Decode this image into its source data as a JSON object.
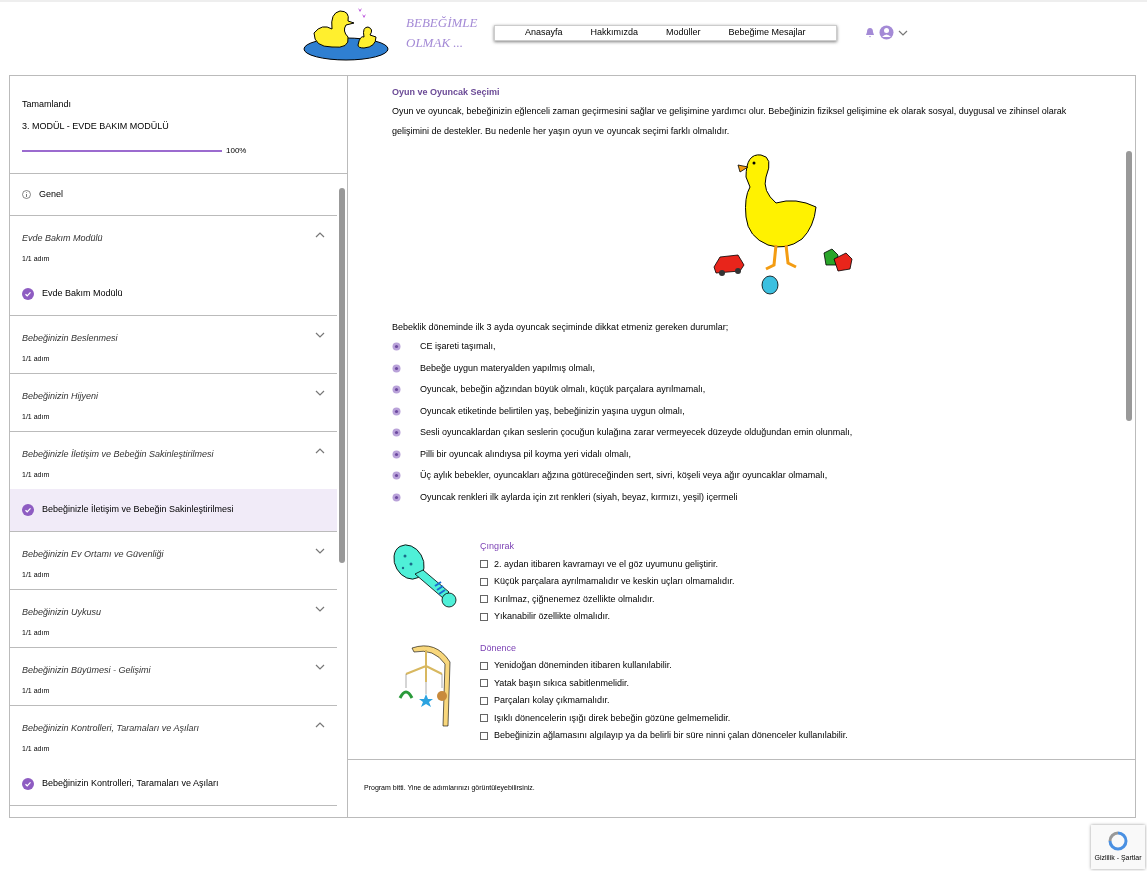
{
  "header": {
    "brand_lines": [
      "BEBEĞİMLE",
      "OLMAK ..."
    ],
    "nav": [
      {
        "label": "Anasayfa",
        "selected": false
      },
      {
        "label": "Hakkımızda",
        "selected": false
      },
      {
        "label": "Modüller",
        "selected": false
      },
      {
        "label": "Bebeğime Mesajlar",
        "selected": false
      }
    ]
  },
  "sidebar": {
    "status": "Tamamlandı",
    "module_title": "3. MODÜL - EVDE BAKIM MODÜLÜ",
    "progress": {
      "level": 1,
      "reading": "100%"
    },
    "general": "Genel",
    "sections": [
      {
        "title": "Evde Bakım Modülü",
        "steps": "1/1 adım",
        "expanded": true,
        "children": [
          {
            "label": "Evde Bakım Modülü",
            "done": true,
            "selected": false
          }
        ]
      },
      {
        "title": "Bebeğinizin Beslenmesi",
        "steps": "1/1 adım",
        "expanded": false
      },
      {
        "title": "Bebeğinizin Hijyeni",
        "steps": "1/1 adım",
        "expanded": false
      },
      {
        "title": "Bebeğinizle İletişim ve Bebeğin Sakinleştirilmesi",
        "steps": "1/1 adım",
        "expanded": true,
        "children": [
          {
            "label": "Bebeğinizle İletişim ve Bebeğin Sakinleştirilmesi",
            "done": true,
            "selected": true
          }
        ]
      },
      {
        "title": "Bebeğinizin Ev Ortamı ve Güvenliği",
        "steps": "1/1 adım",
        "expanded": false
      },
      {
        "title": "Bebeğinizin Uykusu",
        "steps": "1/1 adım",
        "expanded": false
      },
      {
        "title": "Bebeğinizin Büyümesi - Gelişimi",
        "steps": "1/1 adım",
        "expanded": false
      },
      {
        "title": "Bebeğinizin Kontrolleri, Taramaları ve Aşıları",
        "steps": "1/1 adım",
        "expanded": true,
        "children": [
          {
            "label": "Bebeğinizin Kontrolleri, Taramaları ve Aşıları",
            "done": true,
            "selected": false
          }
        ]
      }
    ]
  },
  "content": {
    "heading": "Oyun ve Oyuncak Seçimi",
    "intro": "Oyun ve oyuncak, bebeğinizin eğlenceli zaman geçirmesini sağlar ve gelişimine yardımcı olur. Bebeğinizin fiziksel gelişimine ek olarak sosyal, duygusal ve zihinsel olarak gelişimini de destekler. Bu nedenle her yaşın oyun ve oyuncak seçimi farklı olmalıdır.",
    "list_intro": "Bebeklik döneminde ilk 3 ayda oyuncak seçiminde dikkat etmeniz gereken durumlar;",
    "bullets": [
      "CE işareti taşımalı,",
      "Bebeğe uygun materyalden yapılmış olmalı,",
      "Oyuncak, bebeğin ağzından büyük olmalı, küçük parçalara ayrılmamalı,",
      "Oyuncak etiketinde belirtilen yaş, bebeğinizin yaşına uygun olmalı,",
      "Sesli oyuncaklardan çıkan seslerin çocuğun kulağına zarar vermeyecek düzeyde olduğundan emin olunmalı,",
      "Pilli bir oyuncak alındıysa pil koyma yeri vidalı olmalı,",
      "Üç aylık bebekler, oyuncakları ağzına götüreceğinden sert, sivri, köşeli veya ağır oyuncaklar olmamalı,",
      "Oyuncak renkleri ilk aylarda için zıt renkleri (siyah, beyaz, kırmızı, yeşil) içermeli"
    ],
    "toys": [
      {
        "kind": "rattle",
        "title": "Çıngırak",
        "items": [
          "2. aydan itibaren kavramayı ve el göz uyumunu geliştirir.",
          "Küçük parçalara ayrılmamalıdır ve keskin uçları olmamalıdır.",
          "Kırılmaz, çiğnenemez özellikte olmalıdır.",
          "Yıkanabilir özellikte olmalıdır."
        ]
      },
      {
        "kind": "mobile",
        "title": "Dönence",
        "items": [
          "Yenidoğan döneminden itibaren kullanılabilir.",
          "Yatak başın sıkıca sabitlenmelidir.",
          "Parçaları kolay çıkmamalıdır.",
          "Işıklı dönencelerin ışığı direk bebeğin gözüne gelmemelidir.",
          "Bebeğinizin ağlamasını algılayıp ya da belirli bir süre ninni çalan dönenceler kullanılabilir."
        ]
      }
    ],
    "footer": "Program bitti. Yine de adımlarınızı görüntüleyebilirsiniz."
  },
  "recaptcha": {
    "links": "Gizlilik - Şartlar"
  }
}
